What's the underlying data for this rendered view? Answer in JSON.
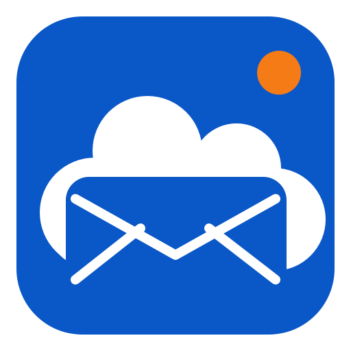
{
  "icon": {
    "name": "cloud-mail-app-icon",
    "colors": {
      "tile": "#0A57C7",
      "cloud": "#FFFFFF",
      "envelope": "#0A57C7",
      "envelope_lines": "#FFFFFF",
      "notification_dot": "#F47B16"
    },
    "has_notification_dot": true
  }
}
